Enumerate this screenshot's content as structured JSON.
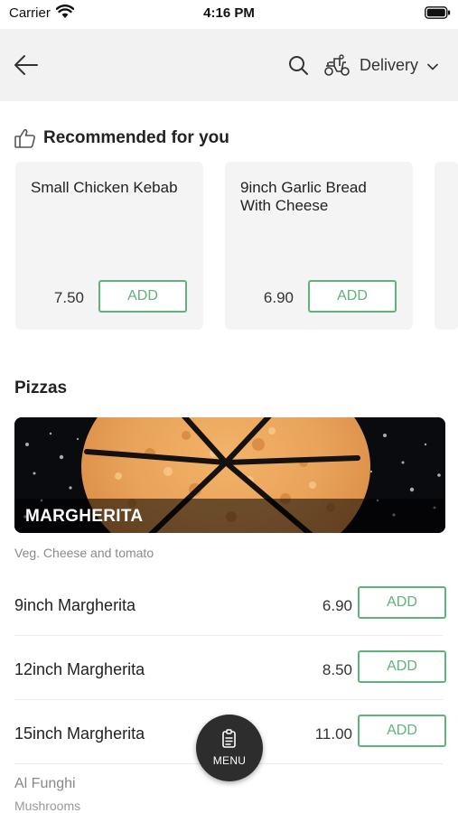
{
  "status_bar": {
    "carrier": "Carrier",
    "time": "4:16 PM"
  },
  "header": {
    "back_icon": "back-arrow-icon",
    "search_icon": "search-icon",
    "delivery_icon": "scooter-icon",
    "delivery_mode": "Delivery",
    "dropdown_icon": "chevron-down-icon"
  },
  "recommended": {
    "title": "Recommended for you",
    "icon": "thumbs-up-icon",
    "items": [
      {
        "name": "Small Chicken Kebab",
        "price": "7.50",
        "add_label": "ADD"
      },
      {
        "name": "9inch Garlic Bread With Cheese",
        "price": "6.90",
        "add_label": "ADD"
      }
    ]
  },
  "category": {
    "title": "Pizzas",
    "banner_name": "MARGHERITA",
    "description": "Veg. Cheese and tomato",
    "items": [
      {
        "name": "9inch Margherita",
        "price": "6.90",
        "add_label": "ADD"
      },
      {
        "name": "12inch Margherita",
        "price": "8.50",
        "add_label": "ADD"
      },
      {
        "name": "15inch Margherita",
        "price": "11.00",
        "add_label": "ADD"
      }
    ]
  },
  "next_item": {
    "name": "Al Funghi",
    "description": "Mushrooms"
  },
  "menu_button": {
    "label": "MENU",
    "icon": "menu-book-icon"
  },
  "colors": {
    "accent": "#5fb27a",
    "header_bg": "#f2f2f2",
    "card_bg": "#f4f4f4",
    "fab_bg": "#2d2d2d"
  }
}
